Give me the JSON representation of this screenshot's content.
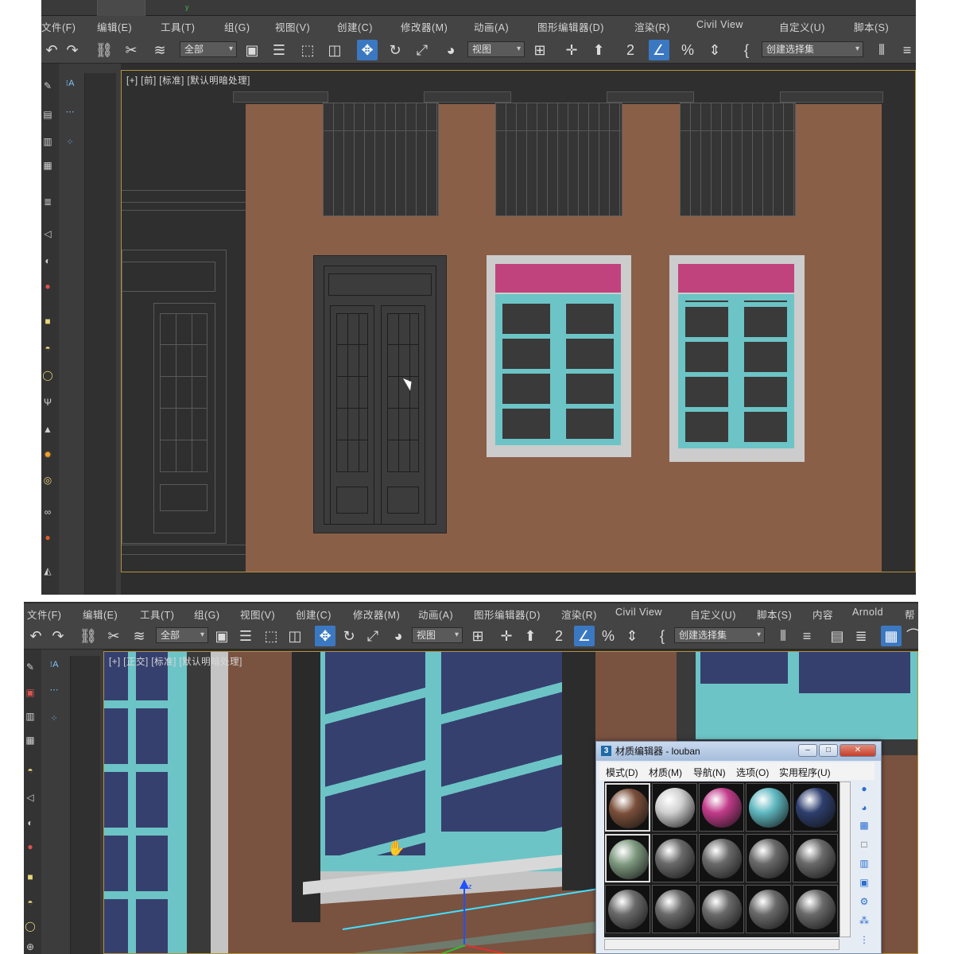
{
  "top_window": {
    "menu": [
      "文件(F)",
      "编辑(E)",
      "工具(T)",
      "组(G)",
      "视图(V)",
      "创建(C)",
      "修改器(M)",
      "动画(A)",
      "图形编辑器(D)",
      "渲染(R)",
      "Civil View",
      "自定义(U)",
      "脚本(S)"
    ],
    "selection_filter": "全部",
    "ref_coord": "视图",
    "named_selection": "创建选择集",
    "viewport_label": "[+] [前] [标准] [默认明暗处理]",
    "timeline_marker": "y"
  },
  "bottom_window": {
    "menu": [
      "文件(F)",
      "编辑(E)",
      "工具(T)",
      "组(G)",
      "视图(V)",
      "创建(C)",
      "修改器(M)",
      "动画(A)",
      "图形编辑器(D)",
      "渲染(R)",
      "Civil View",
      "自定义(U)",
      "脚本(S)",
      "内容",
      "Arnold",
      "帮"
    ],
    "selection_filter": "全部",
    "ref_coord": "视图",
    "named_selection": "创建选择集",
    "viewport_label": "[+] [正交] [标准] [默认明暗处理]",
    "gizmo_axis_z": "z"
  },
  "material_editor": {
    "title": "材质编辑器 - louban",
    "menu": [
      "模式(D)",
      "材质(M)",
      "导航(N)",
      "选项(O)",
      "实用程序(U)"
    ],
    "slots": [
      {
        "color": "#7a4f3a"
      },
      {
        "color": "#d0d0d0"
      },
      {
        "color": "#c23b8a"
      },
      {
        "color": "#5fb8c0"
      },
      {
        "color": "#2e3f6e"
      },
      {
        "color": "#7f9a80"
      },
      {
        "color": "#6a6a6a"
      },
      {
        "color": "#6a6a6a"
      },
      {
        "color": "#6a6a6a"
      },
      {
        "color": "#6a6a6a"
      },
      {
        "color": "#6a6a6a"
      },
      {
        "color": "#6a6a6a"
      },
      {
        "color": "#6a6a6a"
      },
      {
        "color": "#6a6a6a"
      },
      {
        "color": "#6a6a6a"
      }
    ]
  },
  "colors": {
    "wall": "#8a5f48",
    "dark_frame": "#3c3c3c",
    "window_frame": "#6cc4c6",
    "window_sill": "#cccccc",
    "transom": "#c0437e",
    "glass_dark": "#3a3a3a",
    "glass_blue": "#36406e",
    "viewport_border": "#b3923a",
    "active_tool": "#3b78c2"
  }
}
